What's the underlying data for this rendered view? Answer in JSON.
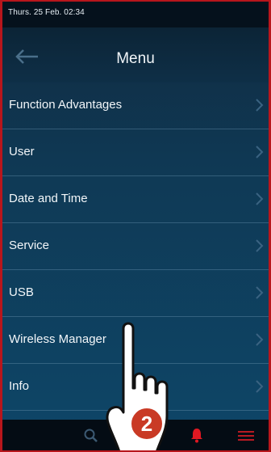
{
  "status": {
    "datetime": "Thurs. 25 Feb. 02:34"
  },
  "header": {
    "title": "Menu",
    "back_icon": "arrow-left-icon"
  },
  "menu": {
    "items": [
      {
        "label": "Function Advantages"
      },
      {
        "label": "User"
      },
      {
        "label": "Date and Time"
      },
      {
        "label": "Service"
      },
      {
        "label": "USB"
      },
      {
        "label": "Wireless Manager"
      },
      {
        "label": "Info"
      }
    ]
  },
  "bottombar": {
    "icons": [
      "search-icon",
      "bell-icon",
      "menu-icon"
    ]
  },
  "callout": {
    "step_number": "2"
  },
  "colors": {
    "frame": "#b8161c",
    "badge": "#c93a25",
    "screen": "#0e3a56"
  }
}
